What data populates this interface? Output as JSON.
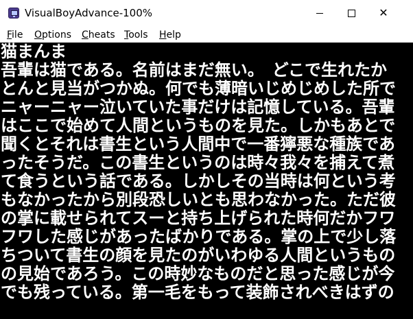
{
  "window": {
    "title": "VisualBoyAdvance-100%",
    "icon": "gameboy-icon",
    "controls": {
      "minimize_icon": "minimize-icon",
      "maximize_icon": "maximize-icon",
      "close_icon": "close-icon",
      "close_glyph": "✕"
    }
  },
  "menu": {
    "items": [
      {
        "first": "F",
        "rest": "ile"
      },
      {
        "first": "O",
        "rest": "ptions"
      },
      {
        "first": "C",
        "rest": "heats"
      },
      {
        "first": "T",
        "rest": "ools"
      },
      {
        "first": "H",
        "rest": "elp"
      }
    ]
  },
  "screen": {
    "background": "#000000",
    "text_color": "#ffffff",
    "lines": [
      "猫まんま",
      "吾輩は猫である。名前はまだ無い。　どこで生れたか",
      "とんと見当がつかぬ。何でも薄暗いじめじめした所で",
      "ニャーニャー泣いていた事だけは記憶している。吾輩",
      "はここで始めて人間というものを見た。しかもあとで",
      "聞くとそれは書生という人間中で一番獰悪な種族であ",
      "ったそうだ。この書生というのは時々我々を捕えて煮",
      "て食うという話である。しかしその当時は何という考",
      "もなかったから別段恐しいとも思わなかった。ただ彼",
      "の掌に載せられてスーと持ち上げられた時何だかフワ",
      "フワした感じがあったばかりである。掌の上で少し落",
      "ちついて書生の顔を見たのがいわゆる人間というもの",
      "の見始であろう。この時妙なものだと思った感じが今",
      "でも残っている。第一毛をもって装飾されべきはずの"
    ]
  }
}
